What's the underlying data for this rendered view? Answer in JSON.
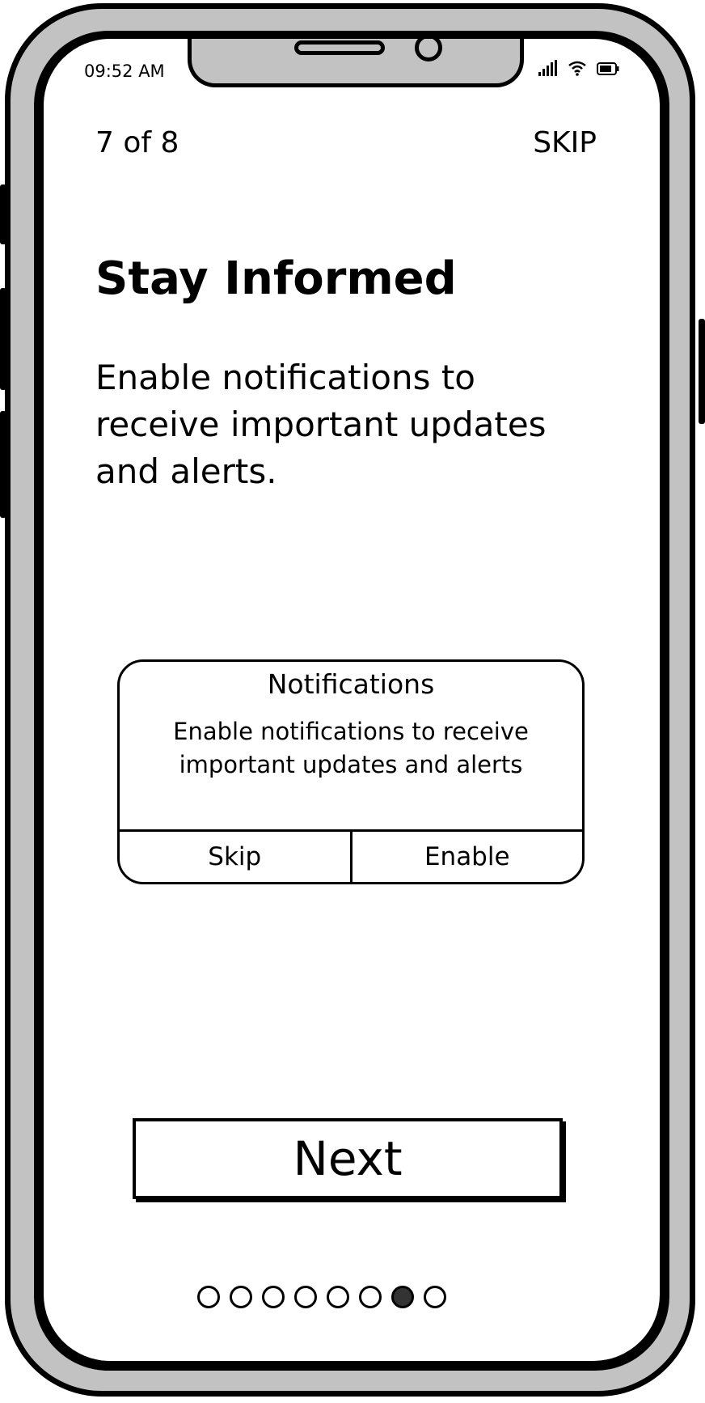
{
  "status_bar": {
    "time": "09:52 AM",
    "icons": [
      "cellular-signal-icon",
      "wifi-icon",
      "battery-icon"
    ]
  },
  "header": {
    "progress_label": "7 of 8",
    "skip_label": "SKIP"
  },
  "content": {
    "title": "Stay Informed",
    "body": "Enable notifications to receive important updates and alerts."
  },
  "dialog": {
    "title": "Notifications",
    "message": "Enable notifications to receive important updates and alerts",
    "skip_label": "Skip",
    "enable_label": "Enable"
  },
  "next_button": {
    "label": "Next"
  },
  "pagination": {
    "total": 8,
    "current": 7
  }
}
